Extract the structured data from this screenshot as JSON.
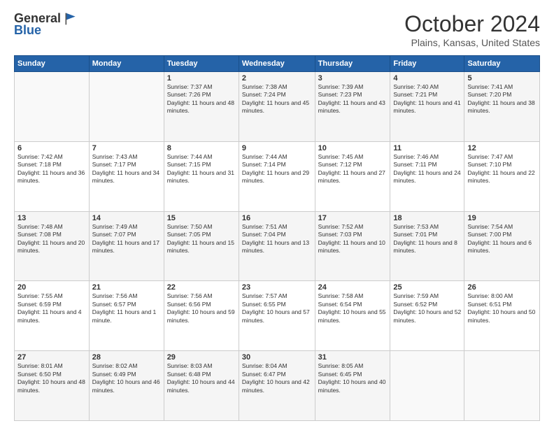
{
  "header": {
    "logo_general": "General",
    "logo_blue": "Blue",
    "month": "October 2024",
    "location": "Plains, Kansas, United States"
  },
  "days_of_week": [
    "Sunday",
    "Monday",
    "Tuesday",
    "Wednesday",
    "Thursday",
    "Friday",
    "Saturday"
  ],
  "weeks": [
    [
      {
        "day": "",
        "info": ""
      },
      {
        "day": "",
        "info": ""
      },
      {
        "day": "1",
        "info": "Sunrise: 7:37 AM\nSunset: 7:26 PM\nDaylight: 11 hours and 48 minutes."
      },
      {
        "day": "2",
        "info": "Sunrise: 7:38 AM\nSunset: 7:24 PM\nDaylight: 11 hours and 45 minutes."
      },
      {
        "day": "3",
        "info": "Sunrise: 7:39 AM\nSunset: 7:23 PM\nDaylight: 11 hours and 43 minutes."
      },
      {
        "day": "4",
        "info": "Sunrise: 7:40 AM\nSunset: 7:21 PM\nDaylight: 11 hours and 41 minutes."
      },
      {
        "day": "5",
        "info": "Sunrise: 7:41 AM\nSunset: 7:20 PM\nDaylight: 11 hours and 38 minutes."
      }
    ],
    [
      {
        "day": "6",
        "info": "Sunrise: 7:42 AM\nSunset: 7:18 PM\nDaylight: 11 hours and 36 minutes."
      },
      {
        "day": "7",
        "info": "Sunrise: 7:43 AM\nSunset: 7:17 PM\nDaylight: 11 hours and 34 minutes."
      },
      {
        "day": "8",
        "info": "Sunrise: 7:44 AM\nSunset: 7:15 PM\nDaylight: 11 hours and 31 minutes."
      },
      {
        "day": "9",
        "info": "Sunrise: 7:44 AM\nSunset: 7:14 PM\nDaylight: 11 hours and 29 minutes."
      },
      {
        "day": "10",
        "info": "Sunrise: 7:45 AM\nSunset: 7:12 PM\nDaylight: 11 hours and 27 minutes."
      },
      {
        "day": "11",
        "info": "Sunrise: 7:46 AM\nSunset: 7:11 PM\nDaylight: 11 hours and 24 minutes."
      },
      {
        "day": "12",
        "info": "Sunrise: 7:47 AM\nSunset: 7:10 PM\nDaylight: 11 hours and 22 minutes."
      }
    ],
    [
      {
        "day": "13",
        "info": "Sunrise: 7:48 AM\nSunset: 7:08 PM\nDaylight: 11 hours and 20 minutes."
      },
      {
        "day": "14",
        "info": "Sunrise: 7:49 AM\nSunset: 7:07 PM\nDaylight: 11 hours and 17 minutes."
      },
      {
        "day": "15",
        "info": "Sunrise: 7:50 AM\nSunset: 7:05 PM\nDaylight: 11 hours and 15 minutes."
      },
      {
        "day": "16",
        "info": "Sunrise: 7:51 AM\nSunset: 7:04 PM\nDaylight: 11 hours and 13 minutes."
      },
      {
        "day": "17",
        "info": "Sunrise: 7:52 AM\nSunset: 7:03 PM\nDaylight: 11 hours and 10 minutes."
      },
      {
        "day": "18",
        "info": "Sunrise: 7:53 AM\nSunset: 7:01 PM\nDaylight: 11 hours and 8 minutes."
      },
      {
        "day": "19",
        "info": "Sunrise: 7:54 AM\nSunset: 7:00 PM\nDaylight: 11 hours and 6 minutes."
      }
    ],
    [
      {
        "day": "20",
        "info": "Sunrise: 7:55 AM\nSunset: 6:59 PM\nDaylight: 11 hours and 4 minutes."
      },
      {
        "day": "21",
        "info": "Sunrise: 7:56 AM\nSunset: 6:57 PM\nDaylight: 11 hours and 1 minute."
      },
      {
        "day": "22",
        "info": "Sunrise: 7:56 AM\nSunset: 6:56 PM\nDaylight: 10 hours and 59 minutes."
      },
      {
        "day": "23",
        "info": "Sunrise: 7:57 AM\nSunset: 6:55 PM\nDaylight: 10 hours and 57 minutes."
      },
      {
        "day": "24",
        "info": "Sunrise: 7:58 AM\nSunset: 6:54 PM\nDaylight: 10 hours and 55 minutes."
      },
      {
        "day": "25",
        "info": "Sunrise: 7:59 AM\nSunset: 6:52 PM\nDaylight: 10 hours and 52 minutes."
      },
      {
        "day": "26",
        "info": "Sunrise: 8:00 AM\nSunset: 6:51 PM\nDaylight: 10 hours and 50 minutes."
      }
    ],
    [
      {
        "day": "27",
        "info": "Sunrise: 8:01 AM\nSunset: 6:50 PM\nDaylight: 10 hours and 48 minutes."
      },
      {
        "day": "28",
        "info": "Sunrise: 8:02 AM\nSunset: 6:49 PM\nDaylight: 10 hours and 46 minutes."
      },
      {
        "day": "29",
        "info": "Sunrise: 8:03 AM\nSunset: 6:48 PM\nDaylight: 10 hours and 44 minutes."
      },
      {
        "day": "30",
        "info": "Sunrise: 8:04 AM\nSunset: 6:47 PM\nDaylight: 10 hours and 42 minutes."
      },
      {
        "day": "31",
        "info": "Sunrise: 8:05 AM\nSunset: 6:45 PM\nDaylight: 10 hours and 40 minutes."
      },
      {
        "day": "",
        "info": ""
      },
      {
        "day": "",
        "info": ""
      }
    ]
  ]
}
